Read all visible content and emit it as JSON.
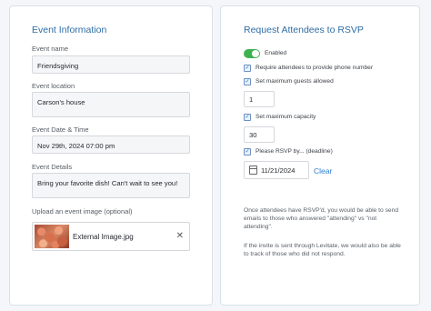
{
  "event_info": {
    "title": "Event Information",
    "name_label": "Event name",
    "name_value": "Friendsgiving",
    "location_label": "Event location",
    "location_value": "Carson's house",
    "datetime_label": "Event Date & Time",
    "datetime_value": "Nov 29th, 2024 07:00 pm",
    "details_label": "Event Details",
    "details_value": "Bring your favorite dish! Can't wait to see you!",
    "upload_label": "Upload an event image (optional)",
    "upload_filename": "External Image.jpg",
    "upload_remove_icon": "close-icon",
    "upload_remove_glyph": "✕"
  },
  "rsvp": {
    "title": "Request Attendees to RSVP",
    "toggle_label": "Enabled",
    "toggle_on": true,
    "accent_color": "#3fb24f",
    "check_glyph": "✓",
    "require_phone_label": "Require attendees to provide phone number",
    "max_guests_label": "Set maximum guests allowed",
    "max_guests_value": "1",
    "max_capacity_label": "Set maximum capacity",
    "max_capacity_value": "30",
    "deadline_label": "Please RSVP by... (deadline)",
    "deadline_value": "11/21/2024",
    "clear_label": "Clear",
    "info_1": "Once attendees have RSVP'd, you would be able to send emails to those who answered \"attending\" vs \"not attending\".",
    "info_2": "If the invite is sent through Levitate, we would also be able to track of those who did not respond."
  }
}
